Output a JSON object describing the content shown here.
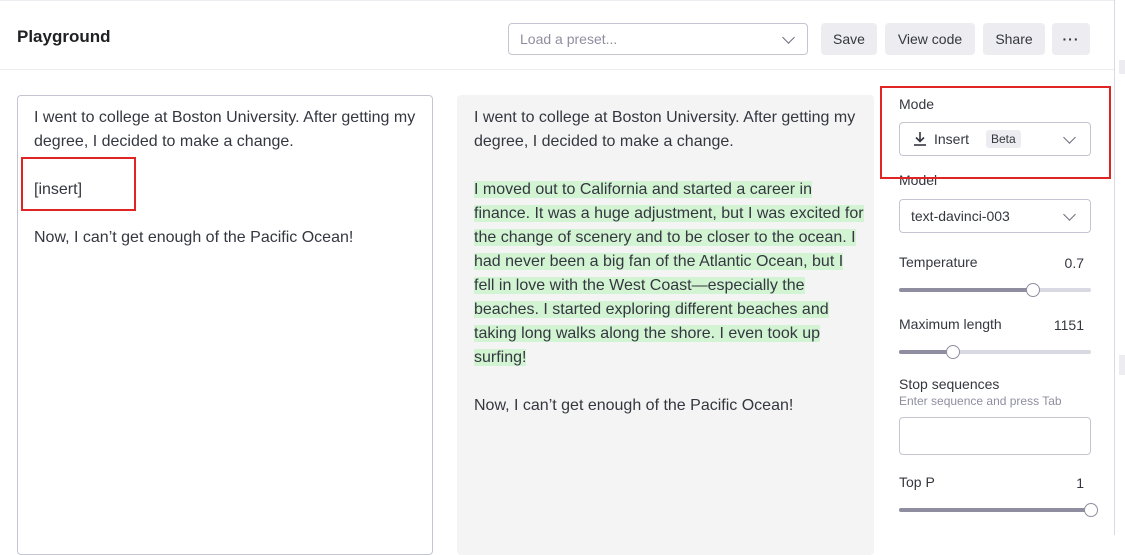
{
  "header": {
    "title": "Playground",
    "preset_placeholder": "Load a preset...",
    "save_label": "Save",
    "view_code_label": "View code",
    "share_label": "Share",
    "more_label": "···"
  },
  "editor": {
    "input_paragraphs": [
      "I went to college at Boston University. After getting my degree, I decided to make a change.",
      "[insert]",
      "Now, I can’t get enough of the Pacific Ocean!"
    ],
    "output_paragraphs": [
      "I went to college at Boston University. After getting my degree, I decided to make a change.",
      "I moved out to California and started a career in finance. It was a huge adjustment, but I was excited for the change of scenery and to be closer to the ocean. I had never been a big fan of the Atlantic Ocean, but I fell in love with the West Coast—especially the beaches. I started exploring different beaches and taking long walks along the shore. I even took up surfing!",
      "Now, I can’t get enough of the Pacific Ocean!"
    ],
    "highlight_color": "#d2f4d3"
  },
  "settings": {
    "mode": {
      "label": "Mode",
      "value": "Insert",
      "badge": "Beta",
      "icon": "insert-download-icon"
    },
    "model": {
      "label": "Model",
      "value": "text-davinci-003"
    },
    "temperature": {
      "label": "Temperature",
      "value": "0.7",
      "level": 0.7
    },
    "maximum_length": {
      "label": "Maximum length",
      "value": "1151",
      "level": 0.28
    },
    "stop_sequences": {
      "label": "Stop sequences",
      "hint": "Enter sequence and press Tab"
    },
    "top_p": {
      "label": "Top P",
      "value": "1",
      "level": 1.0
    }
  },
  "colors": {
    "annotation_red": "#e02424",
    "button_bg": "#ececf1",
    "border": "#c5c5d2"
  }
}
